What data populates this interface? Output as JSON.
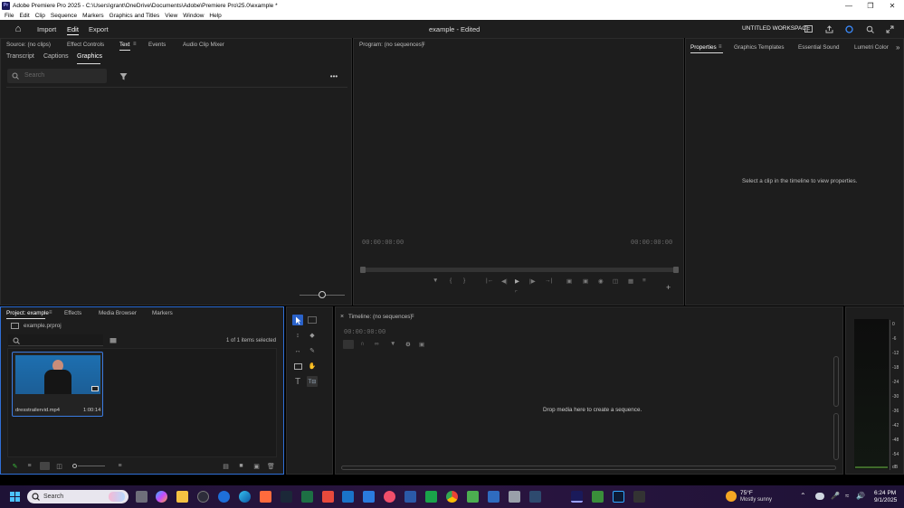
{
  "window": {
    "title": "Adobe Premiere Pro 2025 - C:\\Users\\grant\\OneDrive\\Documents\\Adobe\\Premiere Pro\\25.0\\example *",
    "app_badge": "Pr"
  },
  "menu": [
    "File",
    "Edit",
    "Clip",
    "Sequence",
    "Markers",
    "Graphics and Titles",
    "View",
    "Window",
    "Help"
  ],
  "topbar": {
    "import": "Import",
    "edit": "Edit",
    "export": "Export",
    "project_title": "example",
    "status": "- Edited",
    "workspace": "UNTITLED WORKSPACE"
  },
  "source_panel": {
    "tabs": [
      "Source: (no clips)",
      "Effect Controls",
      "Text",
      "Events",
      "Audio Clip Mixer"
    ],
    "subtabs": [
      "Transcript",
      "Captions",
      "Graphics"
    ],
    "search_placeholder": "Search"
  },
  "program": {
    "title": "Program: (no sequences)",
    "tc_left": "00:00:00:00",
    "tc_right": "00:00:00:00"
  },
  "properties": {
    "tabs": [
      "Properties",
      "Graphics Templates",
      "Essential Sound",
      "Lumetri Color"
    ],
    "message": "Select a clip in the timeline to view properties."
  },
  "project": {
    "tabs": [
      "Project: example",
      "Effects",
      "Media Browser",
      "Markers"
    ],
    "file": "example.prproj",
    "selection": "1 of 1 items selected",
    "clip": {
      "name": "dresstrailervid.mp4",
      "duration": "1:00:14"
    }
  },
  "timeline": {
    "title": "Timeline: (no sequences)",
    "tc": "00:00:00:00",
    "message": "Drop media here to create a sequence."
  },
  "meter": {
    "labels": [
      "0",
      "-6",
      "-12",
      "-18",
      "-24",
      "-30",
      "-36",
      "-42",
      "-48",
      "-54",
      "dB"
    ]
  },
  "taskbar": {
    "search": "Search",
    "weather_temp": "75°F",
    "weather_desc": "Mostly sunny",
    "time": "6:24 PM",
    "date": "9/1/2025"
  }
}
